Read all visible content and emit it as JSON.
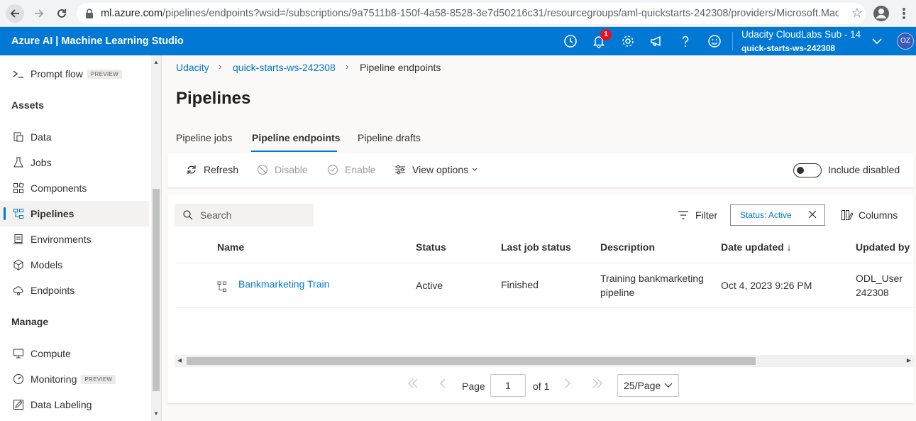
{
  "browser": {
    "url_host": "ml.azure.com",
    "url_path": "/pipelines/endpoints?wsid=/subscriptions/9a7511b8-150f-4a58-8528-3e7d50216c31/resourcegroups/aml-quickstarts-242308/providers/Microsoft.Machi..."
  },
  "topbar": {
    "title": "Azure AI | Machine Learning Studio",
    "notification_count": "1",
    "subscription": "Udacity CloudLabs Sub - 14",
    "workspace": "quick-starts-ws-242308",
    "avatar_initials": "OZ",
    "accent_color": "#0078d4"
  },
  "sidebar": {
    "prompt_flow": "Prompt flow",
    "preview_tag": "PREVIEW",
    "assets_heading": "Assets",
    "assets": [
      "Data",
      "Jobs",
      "Components",
      "Pipelines",
      "Environments",
      "Models",
      "Endpoints"
    ],
    "manage_heading": "Manage",
    "manage": [
      "Compute",
      "Monitoring",
      "Data Labeling"
    ],
    "active": "Pipelines"
  },
  "breadcrumb": [
    "Udacity",
    "quick-starts-ws-242308",
    "Pipeline endpoints"
  ],
  "page_title": "Pipelines",
  "tabs": [
    "Pipeline jobs",
    "Pipeline endpoints",
    "Pipeline drafts"
  ],
  "active_tab": "Pipeline endpoints",
  "commands": {
    "refresh": "Refresh",
    "disable": "Disable",
    "enable": "Enable",
    "view_options": "View options",
    "include_disabled": "Include disabled"
  },
  "table_toolbar": {
    "search_placeholder": "Search",
    "filter": "Filter",
    "filter_pill": "Status: Active",
    "columns": "Columns"
  },
  "table": {
    "columns": [
      "Name",
      "Status",
      "Last job status",
      "Description",
      "Date updated",
      "Updated by"
    ],
    "sort_indicator": "↓",
    "rows": [
      {
        "name": "Bankmarketing Train",
        "status": "Active",
        "last_job_status": "Finished",
        "description_line1": "Training bankmarketing",
        "description_line2": "pipeline",
        "date_updated": "Oct 4, 2023 9:26 PM",
        "updated_by_line1": "ODL_User",
        "updated_by_line2": "242308"
      }
    ]
  },
  "pager": {
    "page_label": "Page",
    "page_value": "1",
    "of_label": "of 1",
    "per_page": "25/Page"
  }
}
